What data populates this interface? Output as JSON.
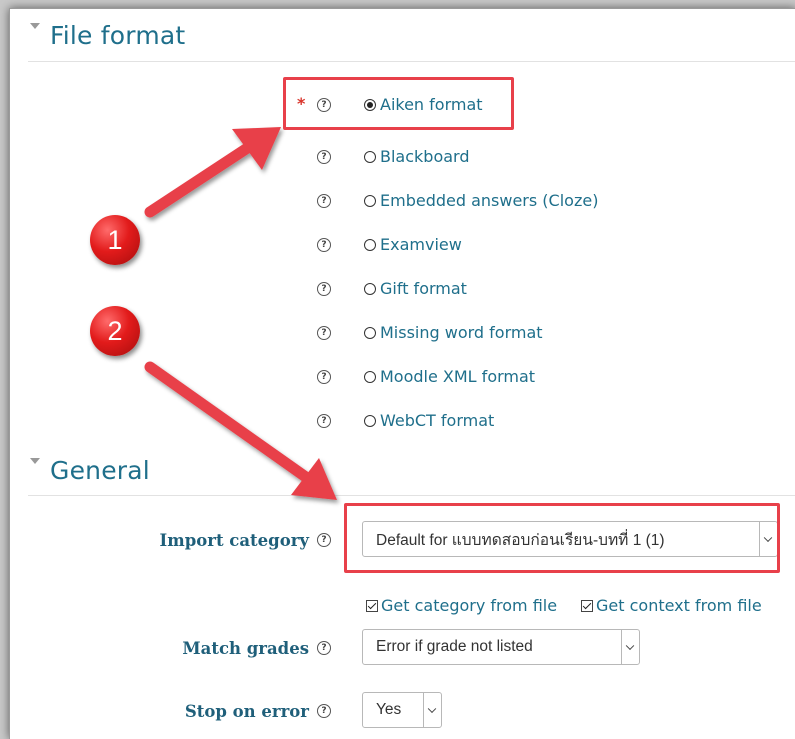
{
  "file_format": {
    "title": "File format",
    "required_marker": "*",
    "options": [
      {
        "label": "Aiken format",
        "selected": true
      },
      {
        "label": "Blackboard",
        "selected": false
      },
      {
        "label": "Embedded answers (Cloze)",
        "selected": false
      },
      {
        "label": "Examview",
        "selected": false
      },
      {
        "label": "Gift format",
        "selected": false
      },
      {
        "label": "Missing word format",
        "selected": false
      },
      {
        "label": "Moodle XML format",
        "selected": false
      },
      {
        "label": "WebCT format",
        "selected": false
      }
    ]
  },
  "general": {
    "title": "General",
    "import_category": {
      "label": "Import category",
      "value": "Default for แบบทดสอบก่อนเรียน-บทที่ 1 (1)"
    },
    "checkboxes": [
      {
        "label": "Get category from file",
        "checked": true
      },
      {
        "label": "Get context from file",
        "checked": true
      }
    ],
    "match_grades": {
      "label": "Match grades",
      "value": "Error if grade not listed"
    },
    "stop_on_error": {
      "label": "Stop on error",
      "value": "Yes"
    }
  },
  "annotations": {
    "badge_1": "1",
    "badge_2": "2"
  },
  "colors": {
    "accent": "#1f6f8b",
    "highlight": "#e8404a",
    "required": "#d9342b"
  },
  "icons": {
    "help": "question-circle-icon",
    "section_toggle": "triangle-down-icon"
  }
}
